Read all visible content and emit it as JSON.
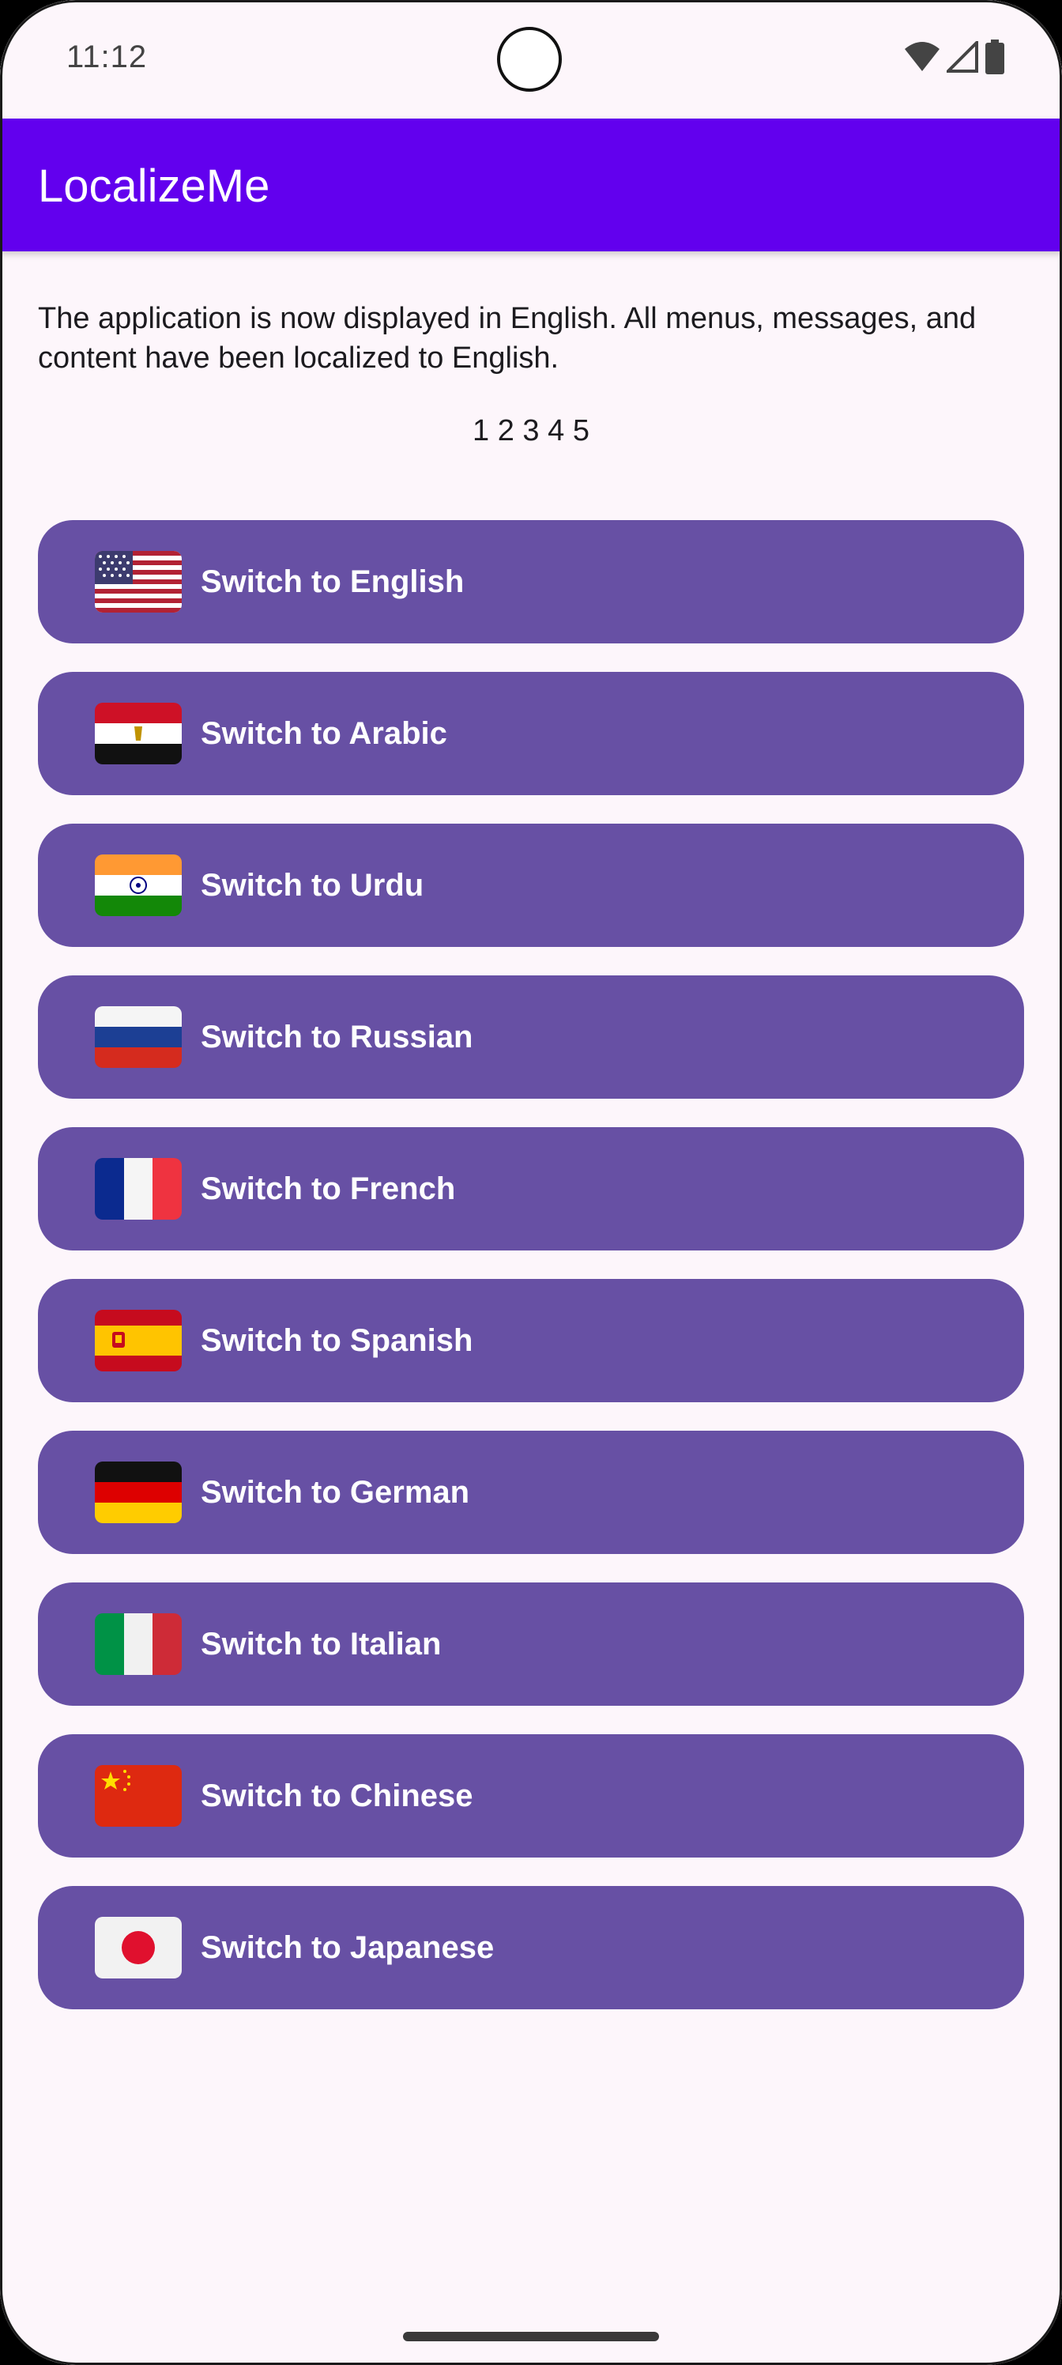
{
  "status_bar": {
    "time": "11:12",
    "icons": [
      "wifi-icon",
      "cell-signal-icon",
      "battery-icon"
    ]
  },
  "app_bar": {
    "title": "LocalizeMe",
    "background_color": "#6200ee"
  },
  "content": {
    "message": "The application is now displayed in English. All menus, messages, and content have been localized to English.",
    "counter": "1 2 3 4 5"
  },
  "languages": [
    {
      "label": "Switch to English",
      "flag": "flag-us-icon"
    },
    {
      "label": "Switch to Arabic",
      "flag": "flag-egypt-icon"
    },
    {
      "label": "Switch to Urdu",
      "flag": "flag-india-icon"
    },
    {
      "label": "Switch to Russian",
      "flag": "flag-russia-icon"
    },
    {
      "label": "Switch to French",
      "flag": "flag-france-icon"
    },
    {
      "label": "Switch to Spanish",
      "flag": "flag-spain-icon"
    },
    {
      "label": "Switch to German",
      "flag": "flag-germany-icon"
    },
    {
      "label": "Switch to Italian",
      "flag": "flag-italy-icon"
    },
    {
      "label": "Switch to Chinese",
      "flag": "flag-china-icon"
    },
    {
      "label": "Switch to Japanese",
      "flag": "flag-japan-icon"
    }
  ],
  "colors": {
    "button": "#6750a4",
    "background": "#fdf6fb",
    "text": "#1c1b1f"
  }
}
